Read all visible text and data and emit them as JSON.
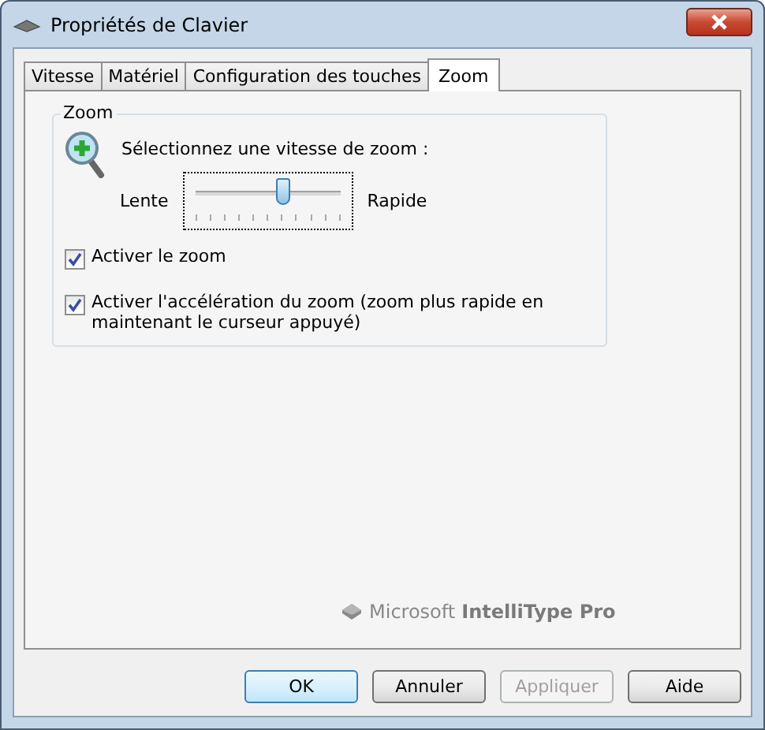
{
  "window": {
    "title": "Propriétés de Clavier"
  },
  "tabs": [
    {
      "label": "Vitesse",
      "selected": false
    },
    {
      "label": "Matériel",
      "selected": false
    },
    {
      "label": "Configuration des touches",
      "selected": false
    },
    {
      "label": "Zoom",
      "selected": true
    }
  ],
  "group": {
    "title": "Zoom",
    "prompt": "Sélectionnez une vitesse de zoom :",
    "slider": {
      "min_label": "Lente",
      "max_label": "Rapide",
      "level": 0.6
    },
    "checkboxes": [
      {
        "label": "Activer le zoom",
        "checked": true
      },
      {
        "label": "Activer l'accélération du zoom (zoom plus rapide en maintenant le curseur appuyé)",
        "checked": true
      }
    ]
  },
  "brand": {
    "company": "Microsoft",
    "product": "IntelliType Pro"
  },
  "buttons": [
    {
      "label": "OK",
      "default": true,
      "disabled": false
    },
    {
      "label": "Annuler",
      "default": false,
      "disabled": false
    },
    {
      "label": "Appliquer",
      "default": false,
      "disabled": true
    },
    {
      "label": "Aide",
      "default": false,
      "disabled": false
    }
  ]
}
